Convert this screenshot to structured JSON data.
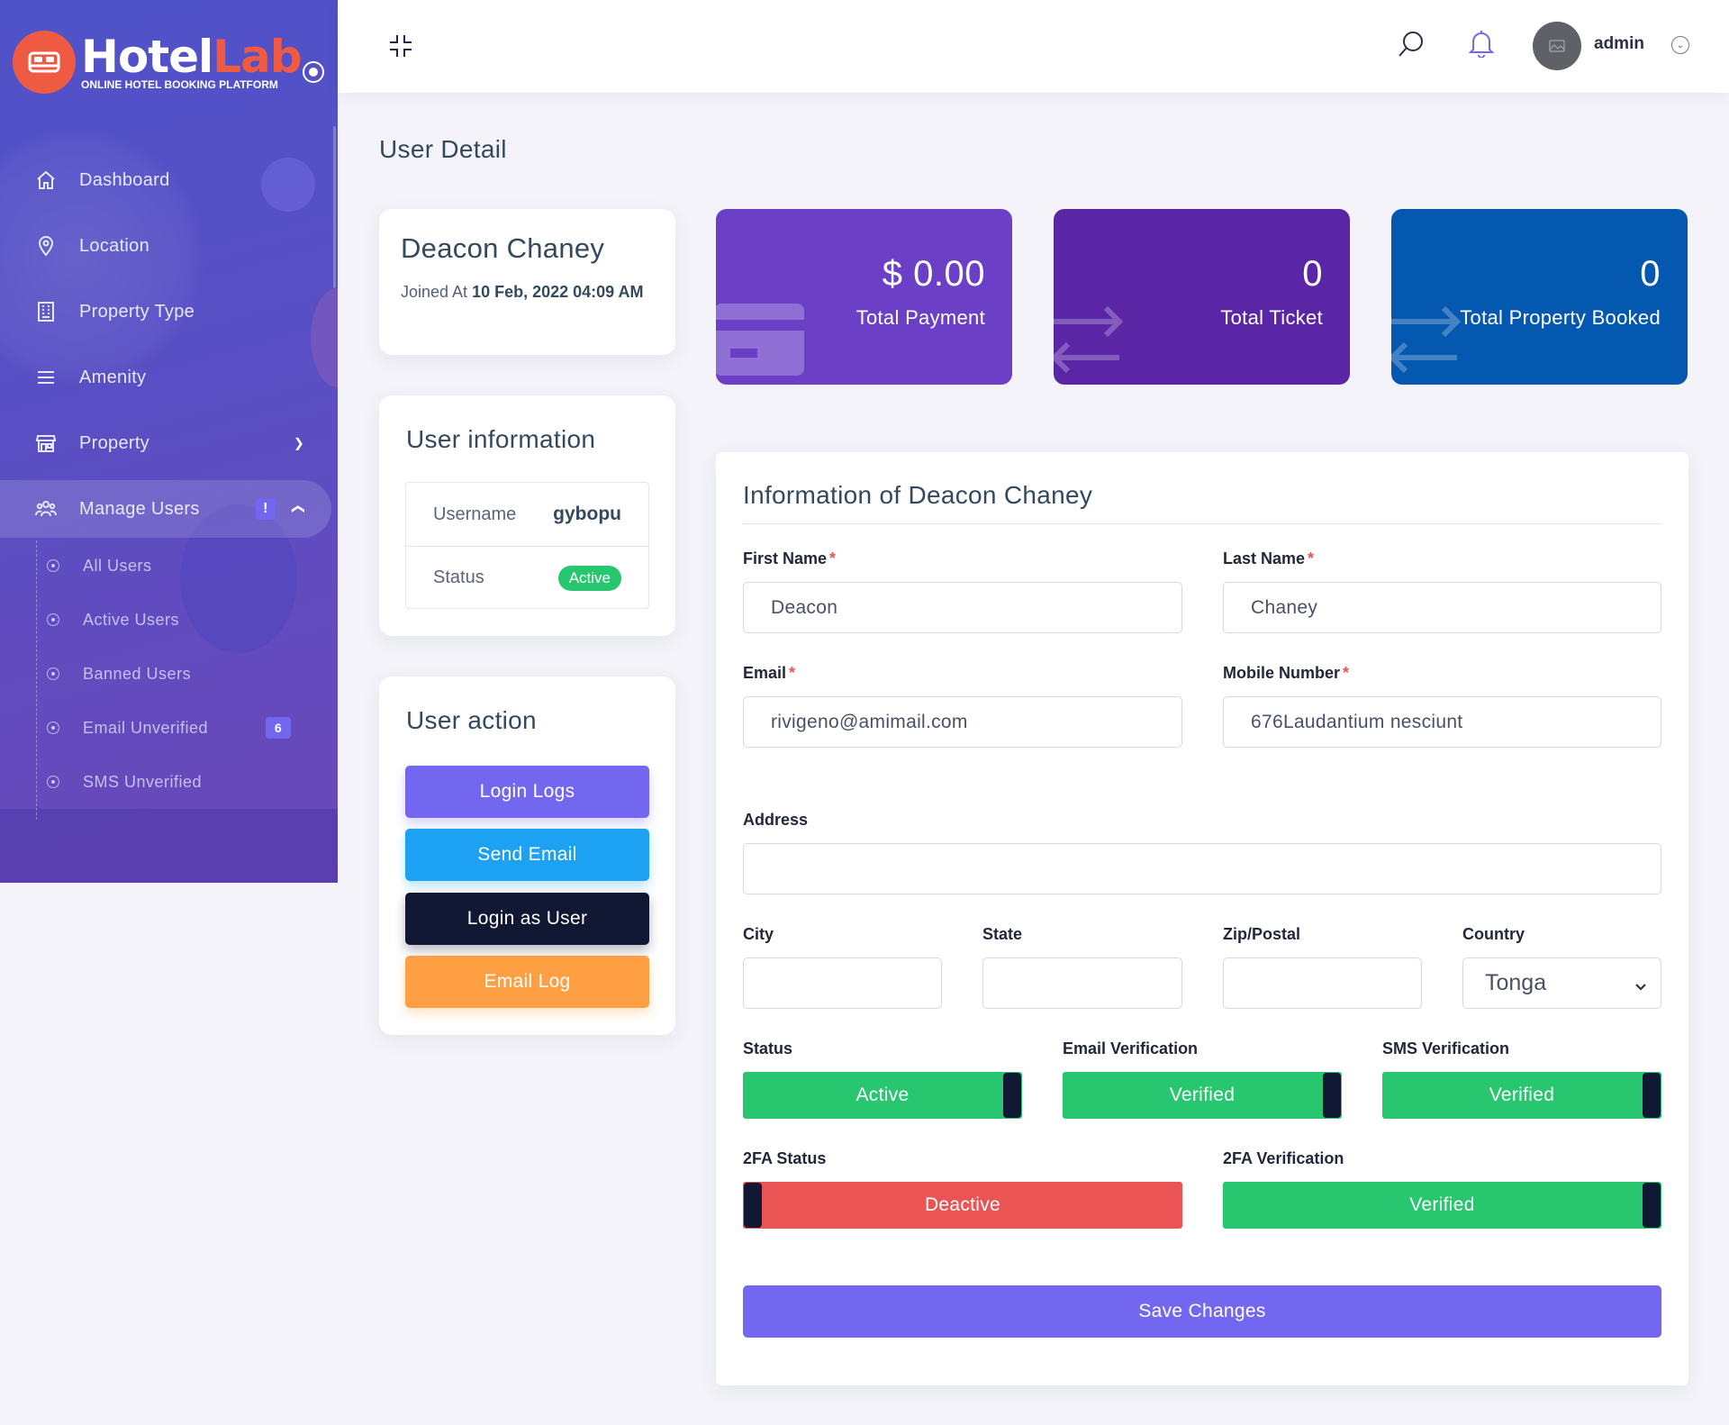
{
  "brand": {
    "name_part1": "Hotel",
    "name_part2": "Lab",
    "tagline": "ONLINE HOTEL BOOKING PLATFORM",
    "accent_color": "#ef5a43"
  },
  "sidebar": {
    "items": [
      {
        "label": "Dashboard",
        "icon": "home-icon"
      },
      {
        "label": "Location",
        "icon": "map-pin-icon"
      },
      {
        "label": "Property Type",
        "icon": "building-icon"
      },
      {
        "label": "Amenity",
        "icon": "menu-lines-icon"
      },
      {
        "label": "Property",
        "icon": "store-icon"
      },
      {
        "label": "Manage Users",
        "icon": "users-icon",
        "badge": "!",
        "expanded": true
      }
    ],
    "subitems": [
      {
        "label": "All Users"
      },
      {
        "label": "Active Users"
      },
      {
        "label": "Banned Users"
      },
      {
        "label": "Email Unverified",
        "badge": "6"
      },
      {
        "label": "SMS Unverified"
      }
    ]
  },
  "topbar": {
    "admin_name": "admin"
  },
  "page": {
    "title": "User Detail"
  },
  "user": {
    "full_name": "Deacon Chaney",
    "joined_prefix": "Joined At",
    "joined_date": "10 Feb, 2022 04:09 AM"
  },
  "stats": [
    {
      "value": "$ 0.00",
      "label": "Total Payment",
      "color": "#6b3fc6"
    },
    {
      "value": "0",
      "label": "Total Ticket",
      "color": "#5a26a6"
    },
    {
      "value": "0",
      "label": "Total Property Booked",
      "color": "#0558b0"
    }
  ],
  "user_info": {
    "title": "User information",
    "username_label": "Username",
    "username_value": "gybopu",
    "status_label": "Status",
    "status_value": "Active"
  },
  "user_action": {
    "title": "User action",
    "buttons": [
      {
        "label": "Login Logs",
        "color": "#7367f0"
      },
      {
        "label": "Send Email",
        "color": "#1da1f2"
      },
      {
        "label": "Login as User",
        "color": "#111833"
      },
      {
        "label": "Email Log",
        "color": "#ff9f43"
      }
    ]
  },
  "form": {
    "title": "Information of Deacon Chaney",
    "first_name_label": "First Name",
    "first_name_value": "Deacon",
    "last_name_label": "Last Name",
    "last_name_value": "Chaney",
    "email_label": "Email",
    "email_value": "rivigeno@amimail.com",
    "mobile_label": "Mobile Number",
    "mobile_value": "676Laudantium nesciunt",
    "address_label": "Address",
    "address_value": "",
    "city_label": "City",
    "city_value": "",
    "state_label": "State",
    "state_value": "",
    "zip_label": "Zip/Postal",
    "zip_value": "",
    "country_label": "Country",
    "country_value": "Tonga",
    "status_label": "Status",
    "status_value": "Active",
    "email_verification_label": "Email Verification",
    "email_verification_value": "Verified",
    "sms_verification_label": "SMS Verification",
    "sms_verification_value": "Verified",
    "twofa_status_label": "2FA Status",
    "twofa_status_value": "Deactive",
    "twofa_verification_label": "2FA Verification",
    "twofa_verification_value": "Verified",
    "save_label": "Save Changes"
  },
  "colors": {
    "success": "#28c76f",
    "danger": "#ea5455",
    "primary": "#7367f0"
  }
}
